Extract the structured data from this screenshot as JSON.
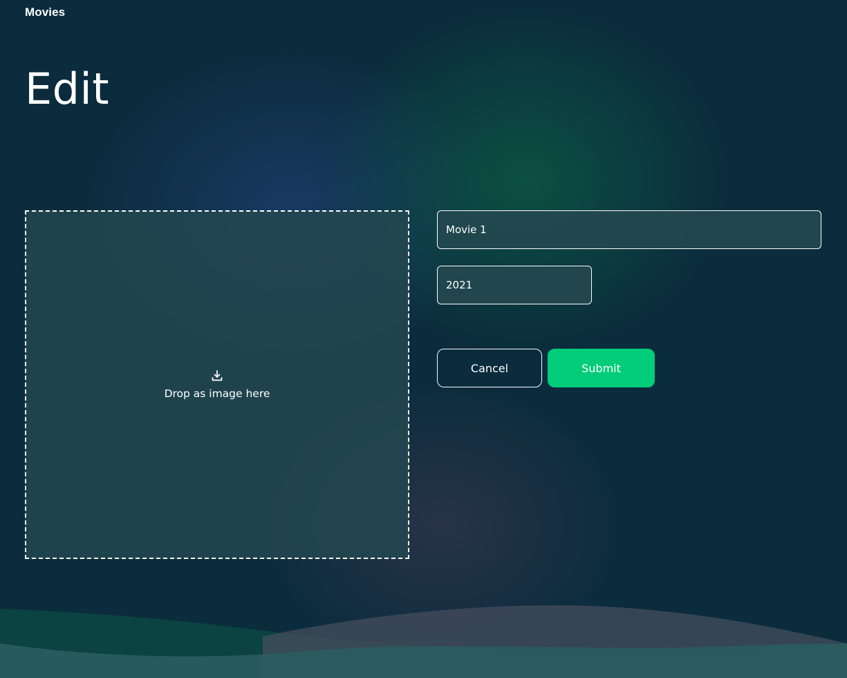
{
  "header": {
    "brand": "Movies"
  },
  "page": {
    "title": "Edit"
  },
  "dropzone": {
    "icon": "download-icon",
    "label": "Drop as image here"
  },
  "form": {
    "title_value": "Movie 1",
    "year_value": "2021",
    "cancel_label": "Cancel",
    "submit_label": "Submit"
  },
  "colors": {
    "background": "#0b2c3d",
    "accent": "#00cc7a",
    "field_bg": "#224650"
  }
}
